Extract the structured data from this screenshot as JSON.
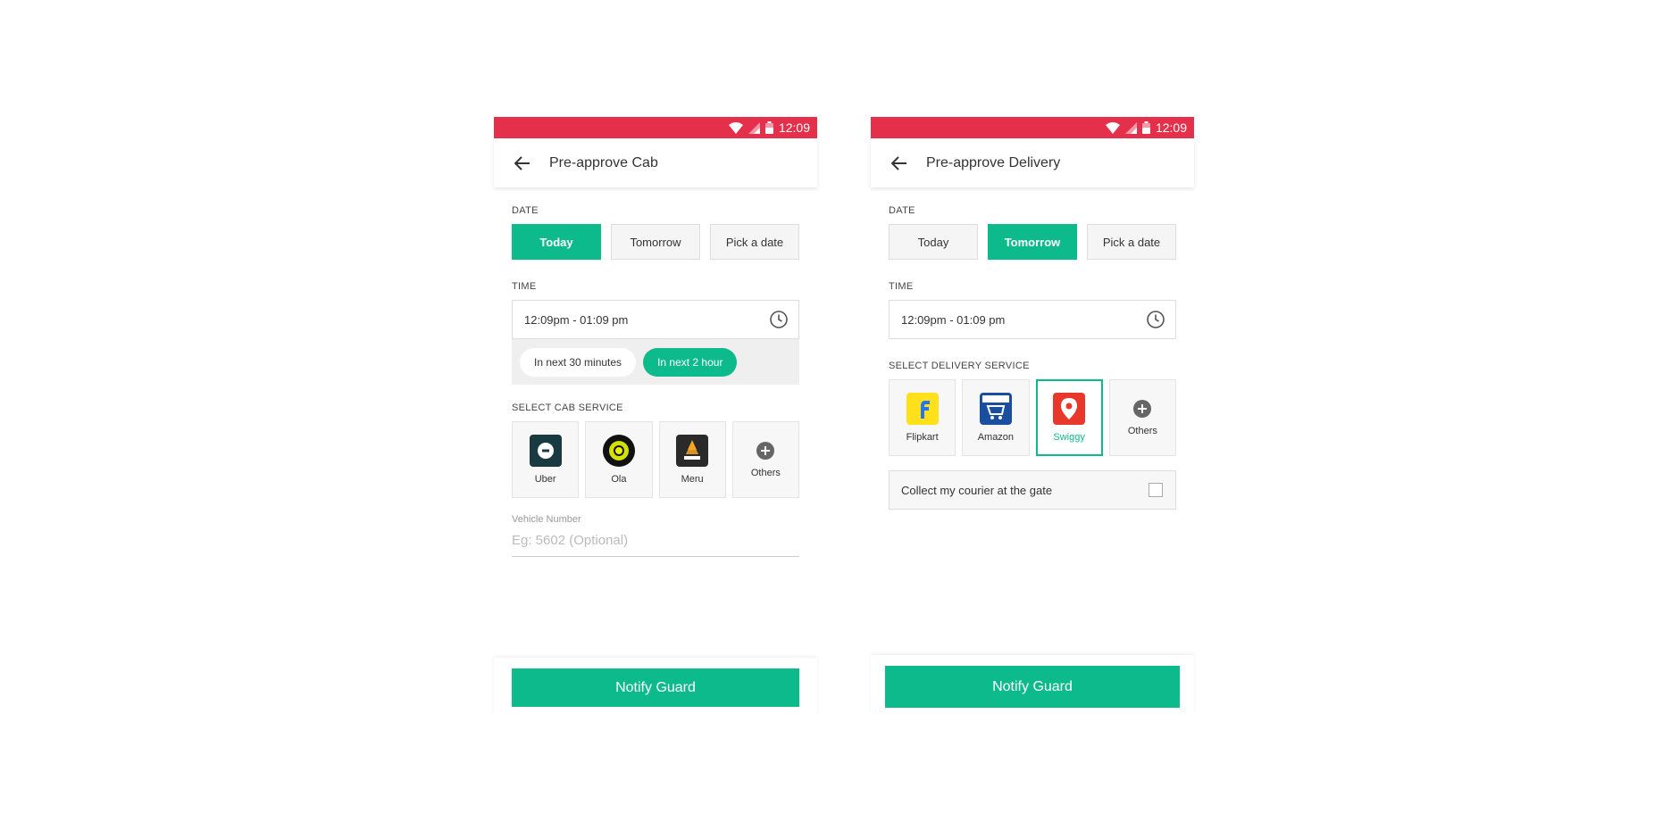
{
  "colors": {
    "status_bar": "#e5304c",
    "accent": "#0dba8c"
  },
  "screens": [
    {
      "status_time": "12:09",
      "title": "Pre-approve Cab",
      "date_label": "DATE",
      "date_options": [
        "Today",
        "Tomorrow",
        "Pick a date"
      ],
      "date_selected": "Today",
      "time_label": "TIME",
      "time_value": "12:09pm - 01:09 pm",
      "quick_options": [
        "In next 30 minutes",
        "In next 2 hour"
      ],
      "quick_selected": "In next 2 hour",
      "service_label": "SELECT CAB SERVICE",
      "services": [
        {
          "name": "Uber",
          "icon": "uber-logo"
        },
        {
          "name": "Ola",
          "icon": "ola-logo"
        },
        {
          "name": "Meru",
          "icon": "meru-logo"
        },
        {
          "name": "Others",
          "icon": "plus-circle-icon"
        }
      ],
      "vehicle_label": "Vehicle Number",
      "vehicle_placeholder": "Eg: 5602 (Optional)",
      "notify_label": "Notify Guard"
    },
    {
      "status_time": "12:09",
      "title": "Pre-approve Delivery",
      "date_label": "DATE",
      "date_options": [
        "Today",
        "Tomorrow",
        "Pick a date"
      ],
      "date_selected": "Tomorrow",
      "time_label": "TIME",
      "time_value": "12:09pm - 01:09 pm",
      "service_label": "SELECT DELIVERY SERVICE",
      "services": [
        {
          "name": "Flipkart",
          "icon": "flipkart-logo"
        },
        {
          "name": "Amazon",
          "icon": "amazon-logo"
        },
        {
          "name": "Swiggy",
          "icon": "swiggy-logo",
          "selected": true
        },
        {
          "name": "Others",
          "icon": "plus-circle-icon"
        }
      ],
      "collect_label": "Collect my courier at the gate",
      "collect_checked": false,
      "notify_label": "Notify Guard"
    }
  ]
}
